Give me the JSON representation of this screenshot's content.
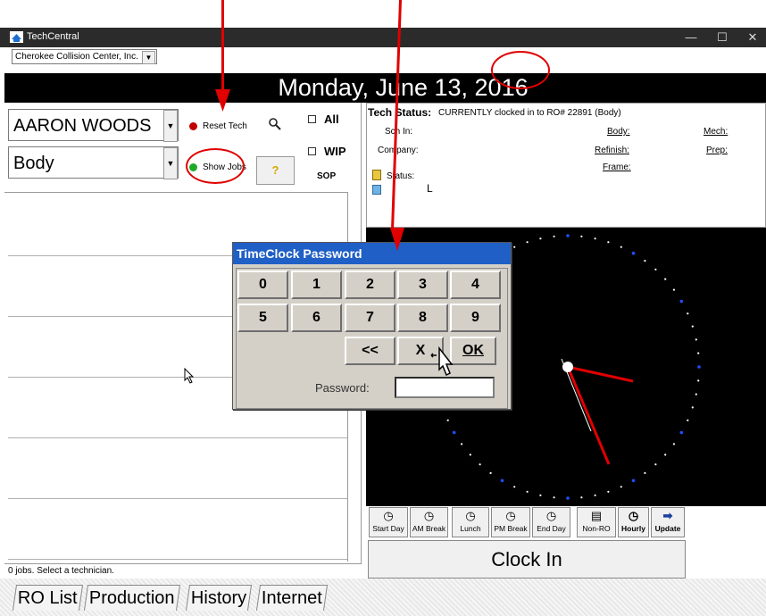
{
  "window": {
    "title": "TechCentral",
    "controls": [
      "—",
      "☐",
      "✕"
    ]
  },
  "company": {
    "selected": "Cherokee Collision Center, Inc."
  },
  "date_header": "Monday, June 13, 2016",
  "tech": {
    "name": "AARON WOODS",
    "department": "Body",
    "reset_label": "Reset Tech",
    "show_jobs_label": "Show Jobs",
    "all_label": "All",
    "wip_label": "WIP",
    "sop_label": "SOP",
    "help_glyph": "?"
  },
  "tech_status": {
    "heading": "Tech Status:",
    "status_text": "CURRENTLY clocked in to RO# 22891 (Body)",
    "sch_in_label": "Sch In:",
    "company_label": "Company:",
    "status_label": "Status:",
    "status_value": "L",
    "body_link": "Body:",
    "refinish_link": "Refinish:",
    "frame_link": "Frame:",
    "mech_link": "Mech:",
    "prep_link": "Prep:"
  },
  "dialog": {
    "title": "TimeClock Password",
    "keys_row1": [
      "0",
      "1",
      "2",
      "3",
      "4"
    ],
    "keys_row2": [
      "5",
      "6",
      "7",
      "8",
      "9"
    ],
    "back_key": "<<",
    "clear_key": "X",
    "ok_key": "OK",
    "password_label": "Password:",
    "password_value": ""
  },
  "toolbar": {
    "buttons": [
      "Start Day",
      "AM Break",
      "Lunch",
      "PM Break",
      "End Day",
      "Non-RO",
      "Hourly",
      "Update"
    ]
  },
  "clock_in_label": "Clock In",
  "status_bar": "0 jobs.  Select a technician.",
  "tabs": [
    "RO List",
    "Production",
    "History",
    "Internet"
  ],
  "colors": {
    "dialog_title": "#1f5fc6",
    "annotation": "#e00000",
    "clock_hands": "#e00000",
    "clock_bg": "#000000"
  }
}
